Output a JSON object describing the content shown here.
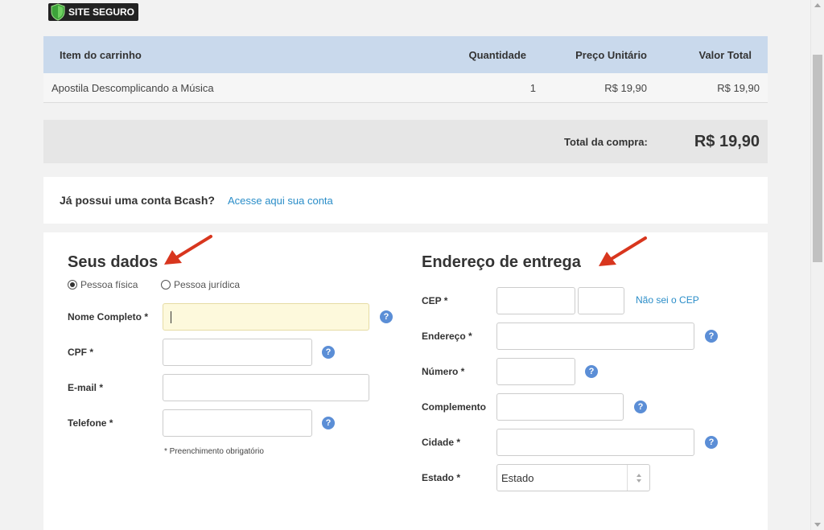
{
  "badge": {
    "label": "SITE SEGURO"
  },
  "cart": {
    "headers": {
      "item": "Item do carrinho",
      "qty": "Quantidade",
      "unit": "Preço Unitário",
      "total": "Valor Total"
    },
    "rows": [
      {
        "item": "Apostila Descomplicando a Música",
        "qty": "1",
        "unit": "R$ 19,90",
        "total": "R$ 19,90"
      }
    ],
    "total_label": "Total da compra:",
    "total_value": "R$ 19,90"
  },
  "account": {
    "question": "Já possui uma conta Bcash?",
    "link": "Acesse aqui sua conta"
  },
  "personal": {
    "title": "Seus dados",
    "person_types": [
      "Pessoa física",
      "Pessoa jurídica"
    ],
    "selected_type": "Pessoa física",
    "fields": {
      "name": "Nome Completo *",
      "cpf": "CPF *",
      "email": "E-mail *",
      "phone": "Telefone *"
    },
    "required_note": "* Preenchimento obrigatório"
  },
  "delivery": {
    "title": "Endereço de entrega",
    "fields": {
      "cep": "CEP *",
      "address": "Endereço *",
      "number": "Número *",
      "complement": "Complemento",
      "city": "Cidade *",
      "state": "Estado *"
    },
    "cep_link": "Não sei o CEP",
    "state_selected": "Estado"
  },
  "help_glyph": "?",
  "colors": {
    "header_bg": "#c9d9ec",
    "link": "#2a8dc8",
    "help": "#5b8ed6",
    "arrow": "#d8361e",
    "focus_bg": "#fdf9dc"
  }
}
